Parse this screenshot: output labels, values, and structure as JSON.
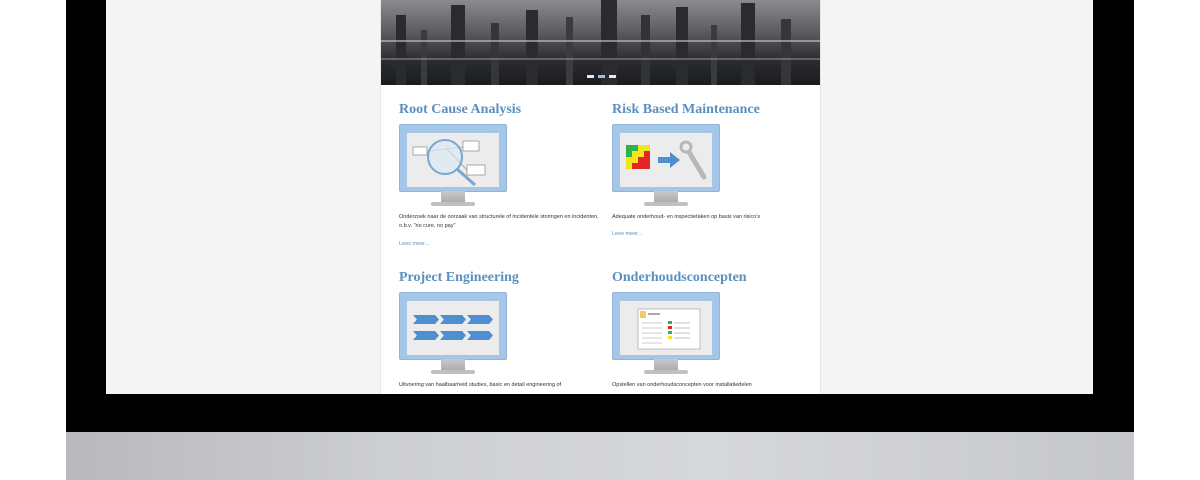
{
  "hero": {
    "slides": [
      1,
      2,
      3
    ],
    "active_slide": 2
  },
  "services": [
    {
      "title": "Root Cause Analysis",
      "desc": "Onderzoek naar de oorzaak van structurele of incidentele storingen en incidenten, o.b.v. \"no cure, no pay\"",
      "link": "Lees meer..."
    },
    {
      "title": "Risk Based Maintenance",
      "desc": "Adequate onderhoud- en inspectietaken op basis van risico's",
      "link": "Lees meer..."
    },
    {
      "title": "Project Engineering",
      "desc": "Uitvoering van  haalbaarheid studies, basic en detail engineering of"
    },
    {
      "title": "Onderhoudsconcepten",
      "desc": "Opstellen van onderhoudsconcepten voor installatiedelen"
    }
  ],
  "colors": {
    "link_blue": "#5b8fbe",
    "monitor_blue": "#a6c6e7"
  }
}
